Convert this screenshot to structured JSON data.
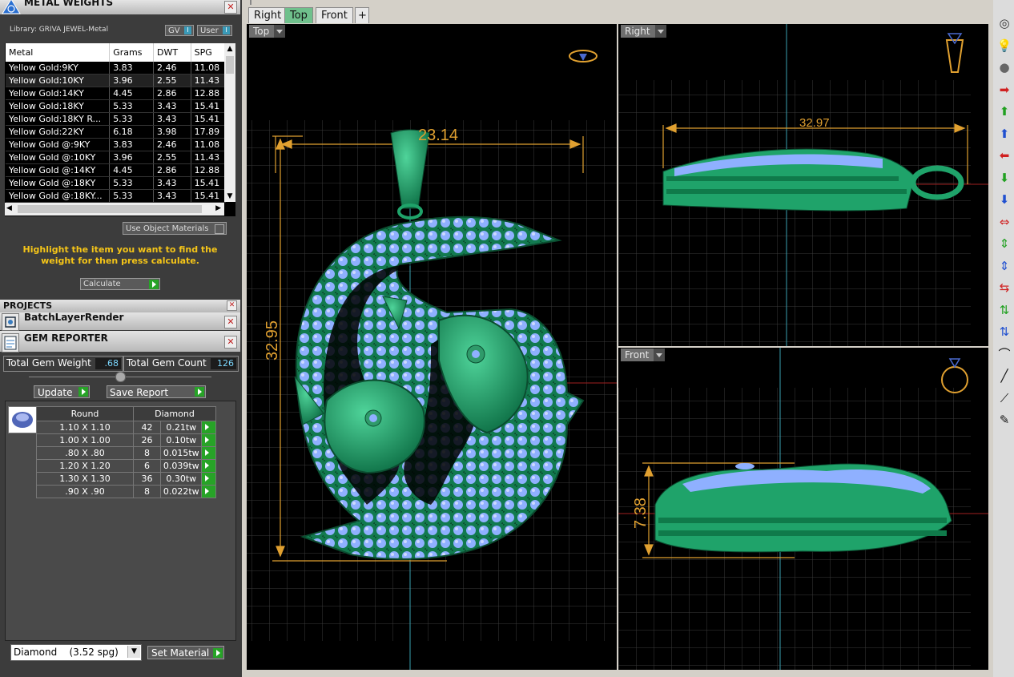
{
  "metal_weights": {
    "title": "METAL WEIGHTS",
    "library": "Library: GRIVA JEWEL-Metal",
    "gv_label": "GV",
    "user_label": "User",
    "toggle_glyph": "I",
    "columns": [
      "Metal",
      "Grams",
      "DWT",
      "SPG"
    ],
    "rows": [
      [
        "Yellow Gold:9KY",
        "3.83",
        "2.46",
        "11.08"
      ],
      [
        "Yellow Gold:10KY",
        "3.96",
        "2.55",
        "11.43"
      ],
      [
        "Yellow Gold:14KY",
        "4.45",
        "2.86",
        "12.88"
      ],
      [
        "Yellow Gold:18KY",
        "5.33",
        "3.43",
        "15.41"
      ],
      [
        "Yellow Gold:18KY R...",
        "5.33",
        "3.43",
        "15.41"
      ],
      [
        "Yellow Gold:22KY",
        "6.18",
        "3.98",
        "17.89"
      ],
      [
        "Yellow Gold @:9KY",
        "3.83",
        "2.46",
        "11.08"
      ],
      [
        "Yellow Gold @:10KY",
        "3.96",
        "2.55",
        "11.43"
      ],
      [
        "Yellow Gold @:14KY",
        "4.45",
        "2.86",
        "12.88"
      ],
      [
        "Yellow Gold @:18KY",
        "5.33",
        "3.43",
        "15.41"
      ],
      [
        "Yellow Gold @:18KY...",
        "5.33",
        "3.43",
        "15.41"
      ]
    ],
    "use_object_materials": "Use Object Materials",
    "hint": "Highlight the item you want to find the weight for then press calculate.",
    "calculate": "Calculate"
  },
  "projects": {
    "title": "PROJECTS"
  },
  "batch": {
    "title": "BatchLayerRender"
  },
  "gem_reporter": {
    "title": "GEM REPORTER",
    "total_weight_label": "Total Gem Weight",
    "total_weight": ".68",
    "total_count_label": "Total Gem Count",
    "total_count": "126",
    "update": "Update",
    "save_report": "Save Report",
    "col_shape": "Round",
    "col_material": "Diamond",
    "rows": [
      [
        "1.10 X 1.10",
        "42",
        "0.21tw"
      ],
      [
        "1.00 X 1.00",
        "26",
        "0.10tw"
      ],
      [
        ".80 X .80",
        "8",
        "0.015tw"
      ],
      [
        "1.20 X 1.20",
        "6",
        "0.039tw"
      ],
      [
        "1.30 X 1.30",
        "36",
        "0.30tw"
      ],
      [
        ".90 X .90",
        "8",
        "0.022tw"
      ]
    ],
    "material_select": "Diamond    (3.52 spg)",
    "set_material": "Set Material"
  },
  "tabs": [
    "Right",
    "Top",
    "Front"
  ],
  "active_tab": "Top",
  "add_tab_glyph": "+",
  "viewports": {
    "top": {
      "label": "Top",
      "dim_width": "23.14",
      "dim_height": "32.95"
    },
    "right": {
      "label": "Right",
      "dim_width": "32.97"
    },
    "front": {
      "label": "Front",
      "dim_height": "7.38"
    }
  },
  "colors": {
    "metal": "#1fa36a",
    "gem": "#8fb0ff",
    "dimension": "#e0a030",
    "grid": "#3a3a3a",
    "accent_yellow": "#f5c518"
  },
  "toolbar_icons": [
    "camera-icon",
    "bulb-icon",
    "sphere-icon",
    "arrow-right-red-icon",
    "arrow-up-green-icon",
    "arrow-up-blue-icon",
    "arrow-left-red-icon",
    "arrow-down-green-icon",
    "arrow-down-blue-icon",
    "double-arrow-red-icon",
    "double-arrow-green-icon",
    "double-arrow-blue-icon",
    "converge-red-icon",
    "converge-green-icon",
    "converge-blue-icon",
    "curve-icon",
    "line-icon",
    "measure-icon",
    "eraser-icon"
  ]
}
